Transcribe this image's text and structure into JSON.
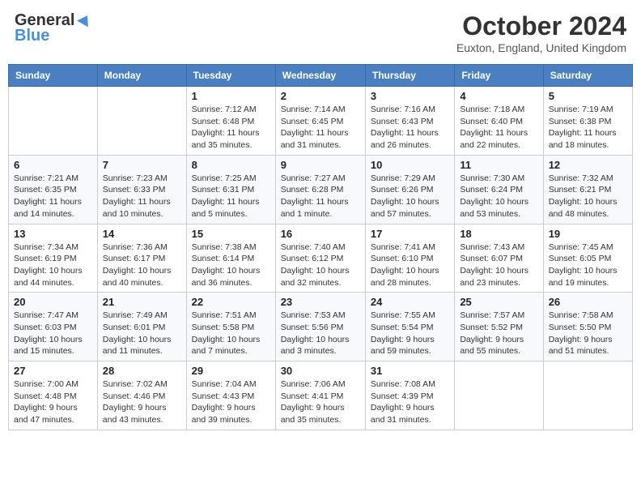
{
  "header": {
    "logo_general": "General",
    "logo_blue": "Blue",
    "month_title": "October 2024",
    "location": "Euxton, England, United Kingdom"
  },
  "weekdays": [
    "Sunday",
    "Monday",
    "Tuesday",
    "Wednesday",
    "Thursday",
    "Friday",
    "Saturday"
  ],
  "weeks": [
    [
      {
        "day": "",
        "info": ""
      },
      {
        "day": "",
        "info": ""
      },
      {
        "day": "1",
        "info": "Sunrise: 7:12 AM\nSunset: 6:48 PM\nDaylight: 11 hours and 35 minutes."
      },
      {
        "day": "2",
        "info": "Sunrise: 7:14 AM\nSunset: 6:45 PM\nDaylight: 11 hours and 31 minutes."
      },
      {
        "day": "3",
        "info": "Sunrise: 7:16 AM\nSunset: 6:43 PM\nDaylight: 11 hours and 26 minutes."
      },
      {
        "day": "4",
        "info": "Sunrise: 7:18 AM\nSunset: 6:40 PM\nDaylight: 11 hours and 22 minutes."
      },
      {
        "day": "5",
        "info": "Sunrise: 7:19 AM\nSunset: 6:38 PM\nDaylight: 11 hours and 18 minutes."
      }
    ],
    [
      {
        "day": "6",
        "info": "Sunrise: 7:21 AM\nSunset: 6:35 PM\nDaylight: 11 hours and 14 minutes."
      },
      {
        "day": "7",
        "info": "Sunrise: 7:23 AM\nSunset: 6:33 PM\nDaylight: 11 hours and 10 minutes."
      },
      {
        "day": "8",
        "info": "Sunrise: 7:25 AM\nSunset: 6:31 PM\nDaylight: 11 hours and 5 minutes."
      },
      {
        "day": "9",
        "info": "Sunrise: 7:27 AM\nSunset: 6:28 PM\nDaylight: 11 hours and 1 minute."
      },
      {
        "day": "10",
        "info": "Sunrise: 7:29 AM\nSunset: 6:26 PM\nDaylight: 10 hours and 57 minutes."
      },
      {
        "day": "11",
        "info": "Sunrise: 7:30 AM\nSunset: 6:24 PM\nDaylight: 10 hours and 53 minutes."
      },
      {
        "day": "12",
        "info": "Sunrise: 7:32 AM\nSunset: 6:21 PM\nDaylight: 10 hours and 48 minutes."
      }
    ],
    [
      {
        "day": "13",
        "info": "Sunrise: 7:34 AM\nSunset: 6:19 PM\nDaylight: 10 hours and 44 minutes."
      },
      {
        "day": "14",
        "info": "Sunrise: 7:36 AM\nSunset: 6:17 PM\nDaylight: 10 hours and 40 minutes."
      },
      {
        "day": "15",
        "info": "Sunrise: 7:38 AM\nSunset: 6:14 PM\nDaylight: 10 hours and 36 minutes."
      },
      {
        "day": "16",
        "info": "Sunrise: 7:40 AM\nSunset: 6:12 PM\nDaylight: 10 hours and 32 minutes."
      },
      {
        "day": "17",
        "info": "Sunrise: 7:41 AM\nSunset: 6:10 PM\nDaylight: 10 hours and 28 minutes."
      },
      {
        "day": "18",
        "info": "Sunrise: 7:43 AM\nSunset: 6:07 PM\nDaylight: 10 hours and 23 minutes."
      },
      {
        "day": "19",
        "info": "Sunrise: 7:45 AM\nSunset: 6:05 PM\nDaylight: 10 hours and 19 minutes."
      }
    ],
    [
      {
        "day": "20",
        "info": "Sunrise: 7:47 AM\nSunset: 6:03 PM\nDaylight: 10 hours and 15 minutes."
      },
      {
        "day": "21",
        "info": "Sunrise: 7:49 AM\nSunset: 6:01 PM\nDaylight: 10 hours and 11 minutes."
      },
      {
        "day": "22",
        "info": "Sunrise: 7:51 AM\nSunset: 5:58 PM\nDaylight: 10 hours and 7 minutes."
      },
      {
        "day": "23",
        "info": "Sunrise: 7:53 AM\nSunset: 5:56 PM\nDaylight: 10 hours and 3 minutes."
      },
      {
        "day": "24",
        "info": "Sunrise: 7:55 AM\nSunset: 5:54 PM\nDaylight: 9 hours and 59 minutes."
      },
      {
        "day": "25",
        "info": "Sunrise: 7:57 AM\nSunset: 5:52 PM\nDaylight: 9 hours and 55 minutes."
      },
      {
        "day": "26",
        "info": "Sunrise: 7:58 AM\nSunset: 5:50 PM\nDaylight: 9 hours and 51 minutes."
      }
    ],
    [
      {
        "day": "27",
        "info": "Sunrise: 7:00 AM\nSunset: 4:48 PM\nDaylight: 9 hours and 47 minutes."
      },
      {
        "day": "28",
        "info": "Sunrise: 7:02 AM\nSunset: 4:46 PM\nDaylight: 9 hours and 43 minutes."
      },
      {
        "day": "29",
        "info": "Sunrise: 7:04 AM\nSunset: 4:43 PM\nDaylight: 9 hours and 39 minutes."
      },
      {
        "day": "30",
        "info": "Sunrise: 7:06 AM\nSunset: 4:41 PM\nDaylight: 9 hours and 35 minutes."
      },
      {
        "day": "31",
        "info": "Sunrise: 7:08 AM\nSunset: 4:39 PM\nDaylight: 9 hours and 31 minutes."
      },
      {
        "day": "",
        "info": ""
      },
      {
        "day": "",
        "info": ""
      }
    ]
  ]
}
